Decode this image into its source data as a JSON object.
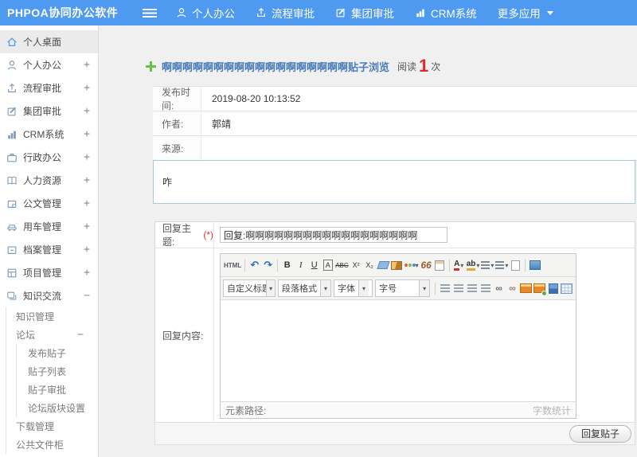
{
  "topbar": {
    "brand": "PHPOA协同办公软件",
    "nav": [
      {
        "label": "个人办公"
      },
      {
        "label": "流程审批"
      },
      {
        "label": "集团审批"
      },
      {
        "label": "CRM系统"
      },
      {
        "label": "更多应用"
      }
    ]
  },
  "sidebar": {
    "items": [
      {
        "label": "个人桌面",
        "expander": ""
      },
      {
        "label": "个人办公",
        "expander": "+"
      },
      {
        "label": "流程审批",
        "expander": "+"
      },
      {
        "label": "集团审批",
        "expander": "+"
      },
      {
        "label": "CRM系统",
        "expander": "+"
      },
      {
        "label": "行政办公",
        "expander": "+"
      },
      {
        "label": "人力资源",
        "expander": "+"
      },
      {
        "label": "公文管理",
        "expander": "+"
      },
      {
        "label": "用车管理",
        "expander": "+"
      },
      {
        "label": "档案管理",
        "expander": "+"
      },
      {
        "label": "项目管理",
        "expander": "+"
      },
      {
        "label": "知识交流",
        "expander": "−"
      }
    ],
    "knowledge": {
      "knowledge_mgmt": "知识管理",
      "forum": "论坛",
      "forum_expander": "−",
      "forum_children": [
        "发布贴子",
        "贴子列表",
        "贴子审批",
        "论坛版块设置"
      ],
      "download_mgmt": "下载管理",
      "public_cabinet": "公共文件柜"
    }
  },
  "main": {
    "title": "啊啊啊啊啊啊啊啊啊啊啊啊啊啊啊啊啊啊贴子浏览",
    "read_label": "阅读",
    "read_count": "1",
    "read_unit": "次",
    "detail": {
      "rows": [
        {
          "label": "发布时间:",
          "value": "2019-08-20 10:13:52"
        },
        {
          "label": "作者:",
          "value": "郭靖"
        },
        {
          "label": "来源:",
          "value": ""
        }
      ],
      "content": "咋"
    },
    "reply": {
      "subject_label": "回复主题:",
      "required_mark": "(*)",
      "subject_value": "回复:啊啊啊啊啊啊啊啊啊啊啊啊啊啊啊啊啊啊",
      "content_label": "回复内容:",
      "submit_label": "回复贴子"
    },
    "editor": {
      "glyphs": {
        "html": "HTML",
        "undo": "↶",
        "redo": "↷",
        "bold": "B",
        "italic": "I",
        "underline": "U",
        "fontbox": "A",
        "strike": "ABC",
        "sup": "X²",
        "sub": "X₂",
        "quote": "66",
        "fontcolor": "A",
        "highlight": "ab",
        "caret": "▾",
        "link": "∞",
        "unlink": "∞"
      },
      "selects": [
        {
          "label": "自定义标题"
        },
        {
          "label": "段落格式"
        },
        {
          "label": "字体"
        },
        {
          "label": "字号"
        }
      ],
      "status_left": "元素路径:",
      "status_right": "字数统计"
    }
  },
  "colors": {
    "topbar_blue": "#4d9af0",
    "title_blue": "#4a7cb8",
    "read_count_red": "#e02a2a",
    "accent_green": "#6abf45"
  }
}
